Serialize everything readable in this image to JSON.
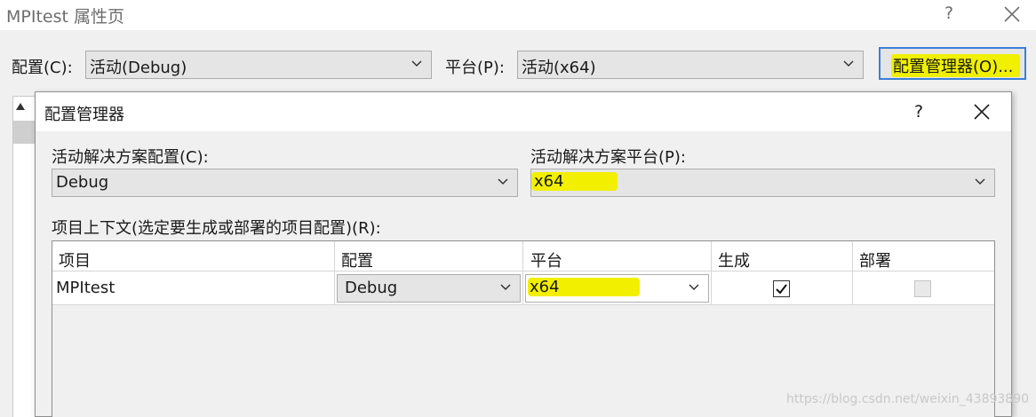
{
  "outer": {
    "title": "MPItest 属性页",
    "help": "?",
    "config_label": "配置(C):",
    "config_value": "活动(Debug)",
    "platform_label": "平台(P):",
    "platform_value": "活动(x64)",
    "config_manager_button": "配置管理器(O)..."
  },
  "dialog": {
    "title": "配置管理器",
    "help": "?",
    "solution_config_label": "活动解决方案配置(C):",
    "solution_config_value": "Debug",
    "solution_platform_label": "活动解决方案平台(P):",
    "solution_platform_value": "x64",
    "grid_label": "项目上下文(选定要生成或部署的项目配置)(R):",
    "columns": [
      "项目",
      "配置",
      "平台",
      "生成",
      "部署"
    ],
    "rows": [
      {
        "project": "MPItest",
        "config": "Debug",
        "platform": "x64",
        "build": true,
        "deploy": false
      }
    ]
  },
  "watermark": "https://blog.csdn.net/weixin_43893890",
  "colors": {
    "highlight": "#f2f000",
    "focus_border": "#3c7fd6"
  }
}
